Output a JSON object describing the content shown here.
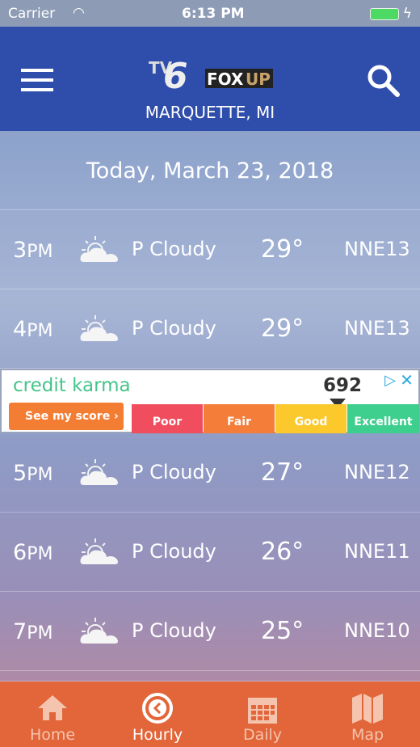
{
  "status": {
    "carrier": "Carrier",
    "time": "6:13 PM"
  },
  "header": {
    "logo": "TV6 FOX UP",
    "location": "MARQUETTE, MI"
  },
  "date": "Today, March 23, 2018",
  "hours": [
    {
      "hour": "3",
      "ampm": "PM",
      "condition": "P Cloudy",
      "temp": "29°",
      "wind": "NNE13"
    },
    {
      "hour": "4",
      "ampm": "PM",
      "condition": "P Cloudy",
      "temp": "29°",
      "wind": "NNE13"
    },
    {
      "hour": "5",
      "ampm": "PM",
      "condition": "P Cloudy",
      "temp": "27°",
      "wind": "NNE12"
    },
    {
      "hour": "6",
      "ampm": "PM",
      "condition": "P Cloudy",
      "temp": "26°",
      "wind": "NNE11"
    },
    {
      "hour": "7",
      "ampm": "PM",
      "condition": "P Cloudy",
      "temp": "25°",
      "wind": "NNE10"
    }
  ],
  "ad": {
    "brand": "credit karma",
    "button": "See my score",
    "score": "692",
    "levels": [
      "Poor",
      "Fair",
      "Good",
      "Excellent"
    ],
    "colors": [
      "#f04e5e",
      "#f47d3a",
      "#fcc92c",
      "#3ecf8e"
    ]
  },
  "nav": [
    {
      "label": "Home",
      "icon": "home-icon"
    },
    {
      "label": "Hourly",
      "icon": "clock-icon",
      "active": true
    },
    {
      "label": "Daily",
      "icon": "calendar-icon"
    },
    {
      "label": "Map",
      "icon": "map-icon"
    }
  ]
}
